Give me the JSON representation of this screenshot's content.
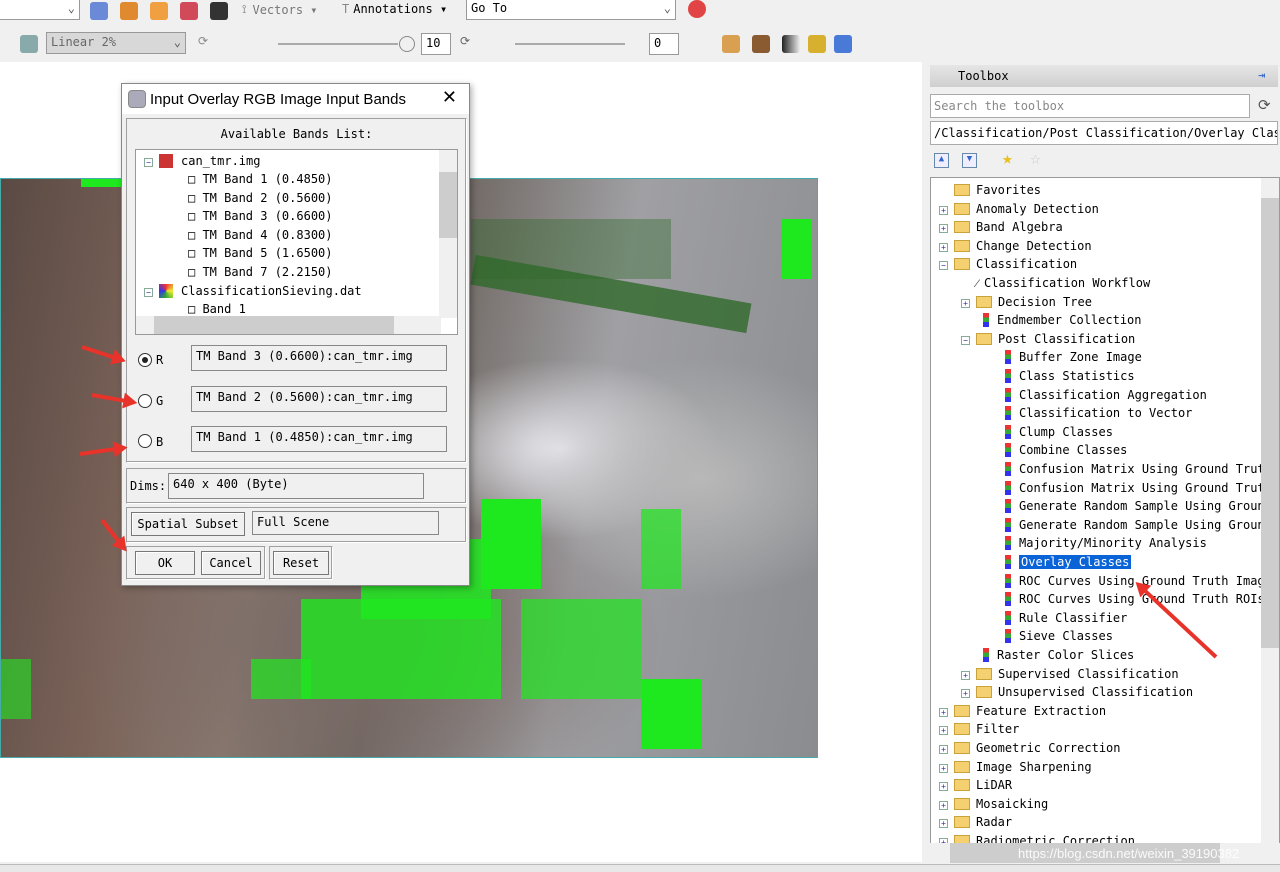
{
  "toolbar": {
    "vectors_label": "Vectors",
    "annotations_label": "Annotations",
    "goto_value": "Go To",
    "stretch_value": "Linear 2%",
    "sharpen_value": "10",
    "transparency_value": "0"
  },
  "dialog": {
    "title": "Input Overlay RGB Image Input Bands",
    "list_label": "Available Bands List:",
    "files": [
      {
        "name": "can_tmr.img",
        "bands": [
          "TM Band 1 (0.4850)",
          "TM Band 2 (0.5600)",
          "TM Band 3 (0.6600)",
          "TM Band 4 (0.8300)",
          "TM Band 5 (1.6500)",
          "TM Band 7 (2.2150)"
        ]
      },
      {
        "name": "ClassificationSieving.dat",
        "bands": [
          "Band 1"
        ]
      }
    ],
    "rgb": [
      {
        "label": "R",
        "value": "TM Band 3 (0.6600):can_tmr.img",
        "selected": true
      },
      {
        "label": "G",
        "value": "TM Band 2 (0.5600):can_tmr.img",
        "selected": false
      },
      {
        "label": "B",
        "value": "TM Band 1 (0.4850):can_tmr.img",
        "selected": false
      }
    ],
    "dims_label": "Dims:",
    "dims_value": "640 x 400 (Byte)",
    "spatial_subset_label": "Spatial Subset",
    "spatial_subset_value": "Full Scene",
    "ok": "OK",
    "cancel": "Cancel",
    "reset": "Reset"
  },
  "toolbox": {
    "title": "Toolbox",
    "search_placeholder": "Search the toolbox",
    "path": "/Classification/Post Classification/Overlay Class",
    "items": [
      {
        "label": "Favorites",
        "level": 0,
        "type": "fav"
      },
      {
        "label": "Anomaly Detection",
        "level": 0,
        "type": "folder"
      },
      {
        "label": "Band Algebra",
        "level": 0,
        "type": "folder"
      },
      {
        "label": "Change Detection",
        "level": 0,
        "type": "folder"
      },
      {
        "label": "Classification",
        "level": 0,
        "type": "folder-open"
      },
      {
        "label": "Classification Workflow",
        "level": 1,
        "type": "wand"
      },
      {
        "label": "Decision Tree",
        "level": 1,
        "type": "folder"
      },
      {
        "label": "Endmember Collection",
        "level": 1,
        "type": "tool"
      },
      {
        "label": "Post Classification",
        "level": 1,
        "type": "folder-open"
      },
      {
        "label": "Buffer Zone Image",
        "level": 2,
        "type": "tool"
      },
      {
        "label": "Class Statistics",
        "level": 2,
        "type": "tool"
      },
      {
        "label": "Classification Aggregation",
        "level": 2,
        "type": "tool"
      },
      {
        "label": "Classification to Vector",
        "level": 2,
        "type": "tool"
      },
      {
        "label": "Clump Classes",
        "level": 2,
        "type": "tool"
      },
      {
        "label": "Combine Classes",
        "level": 2,
        "type": "tool"
      },
      {
        "label": "Confusion Matrix Using Ground Truth Image",
        "level": 2,
        "type": "tool"
      },
      {
        "label": "Confusion Matrix Using Ground Truth ROIs",
        "level": 2,
        "type": "tool"
      },
      {
        "label": "Generate Random Sample Using Ground Truth Image",
        "level": 2,
        "type": "tool"
      },
      {
        "label": "Generate Random Sample Using Ground Truth ROIs",
        "level": 2,
        "type": "tool"
      },
      {
        "label": "Majority/Minority Analysis",
        "level": 2,
        "type": "tool"
      },
      {
        "label": "Overlay Classes",
        "level": 2,
        "type": "tool",
        "selected": true
      },
      {
        "label": "ROC Curves Using Ground Truth Image",
        "level": 2,
        "type": "tool"
      },
      {
        "label": "ROC Curves Using Ground Truth ROIs",
        "level": 2,
        "type": "tool"
      },
      {
        "label": "Rule Classifier",
        "level": 2,
        "type": "tool"
      },
      {
        "label": "Sieve Classes",
        "level": 2,
        "type": "tool"
      },
      {
        "label": "Raster Color Slices",
        "level": 1,
        "type": "tool"
      },
      {
        "label": "Supervised Classification",
        "level": 1,
        "type": "folder"
      },
      {
        "label": "Unsupervised Classification",
        "level": 1,
        "type": "folder"
      },
      {
        "label": "Feature Extraction",
        "level": 0,
        "type": "folder"
      },
      {
        "label": "Filter",
        "level": 0,
        "type": "folder"
      },
      {
        "label": "Geometric Correction",
        "level": 0,
        "type": "folder"
      },
      {
        "label": "Image Sharpening",
        "level": 0,
        "type": "folder"
      },
      {
        "label": "LiDAR",
        "level": 0,
        "type": "folder"
      },
      {
        "label": "Mosaicking",
        "level": 0,
        "type": "folder"
      },
      {
        "label": "Radar",
        "level": 0,
        "type": "folder"
      },
      {
        "label": "Radiometric Correction",
        "level": 0,
        "type": "folder"
      }
    ]
  },
  "watermark": "https://blog.csdn.net/weixin_39190382"
}
